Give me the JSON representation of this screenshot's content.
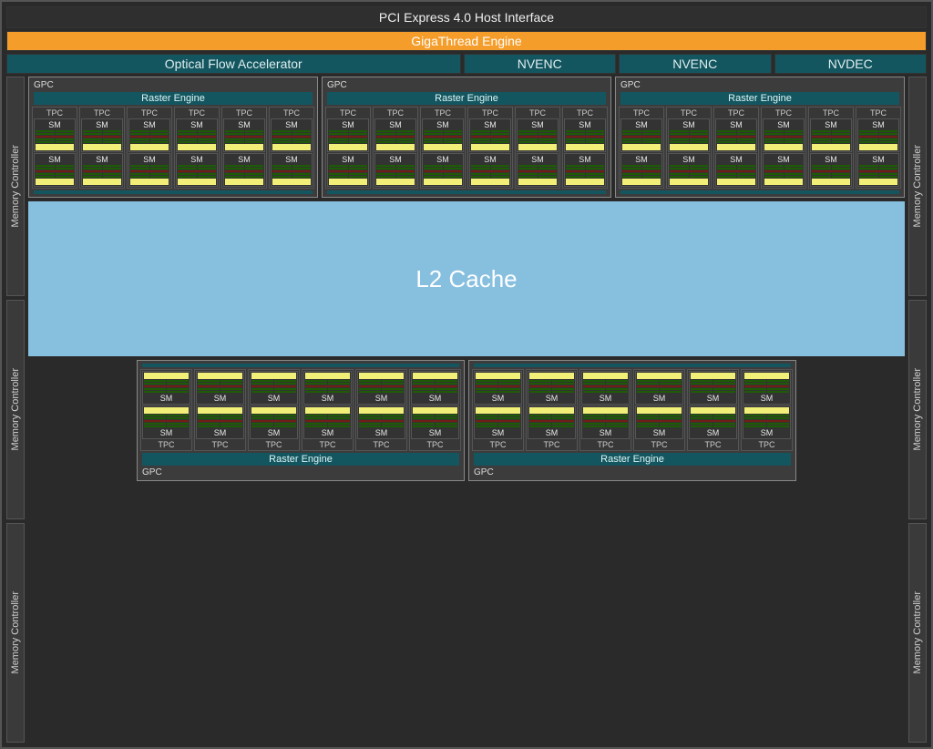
{
  "top": {
    "pcie": "PCI Express 4.0 Host Interface",
    "gigathread": "GigaThread Engine",
    "engines": {
      "ofa": "Optical Flow Accelerator",
      "nvenc1": "NVENC",
      "nvenc2": "NVENC",
      "nvdec": "NVDEC"
    }
  },
  "labels": {
    "gpc": "GPC",
    "raster": "Raster Engine",
    "tpc": "TPC",
    "sm": "SM",
    "memctrl": "Memory Controller",
    "l2": "L2 Cache"
  },
  "structure": {
    "top_gpc_count": 3,
    "bottom_gpc_count": 2,
    "tpcs_per_gpc": 6,
    "sms_per_tpc": 2,
    "mem_controllers_per_side": 3
  }
}
